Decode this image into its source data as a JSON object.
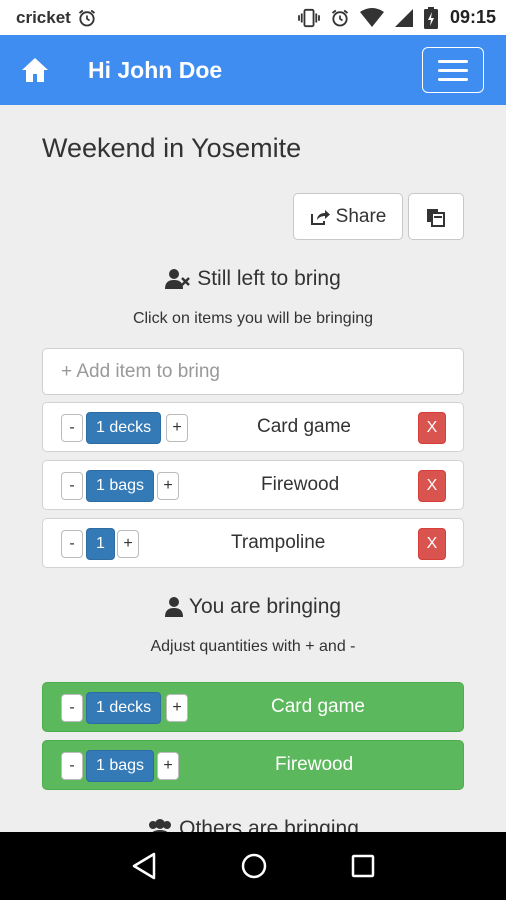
{
  "status_bar": {
    "carrier": "cricket",
    "time": "09:15"
  },
  "navbar": {
    "greeting": "Hi John Doe"
  },
  "trip": {
    "title": "Weekend in Yosemite"
  },
  "actions": {
    "share_label": "Share"
  },
  "still_left": {
    "heading": "Still left to bring",
    "subtitle": "Click on items you will be bringing",
    "add_placeholder": "+ Add item to bring",
    "items": [
      {
        "minus": "-",
        "quantity": "1 decks",
        "plus": "+",
        "name": "Card game",
        "delete": "X"
      },
      {
        "minus": "-",
        "quantity": "1 bags",
        "plus": "+",
        "name": "Firewood",
        "delete": "X"
      },
      {
        "minus": "-",
        "quantity": "1",
        "plus": "+",
        "name": "Trampoline",
        "delete": "X"
      }
    ]
  },
  "you_bringing": {
    "heading": "You are bringing",
    "subtitle": "Adjust quantities with + and -",
    "items": [
      {
        "minus": "-",
        "quantity": "1 decks",
        "plus": "+",
        "name": "Card game"
      },
      {
        "minus": "-",
        "quantity": "1 bags",
        "plus": "+",
        "name": "Firewood"
      }
    ]
  },
  "others": {
    "heading": "Others are bringing"
  },
  "colors": {
    "navbar": "#3f8df0",
    "quantity": "#337ab7",
    "delete": "#d9534f",
    "bringing_row": "#5cb85c"
  }
}
